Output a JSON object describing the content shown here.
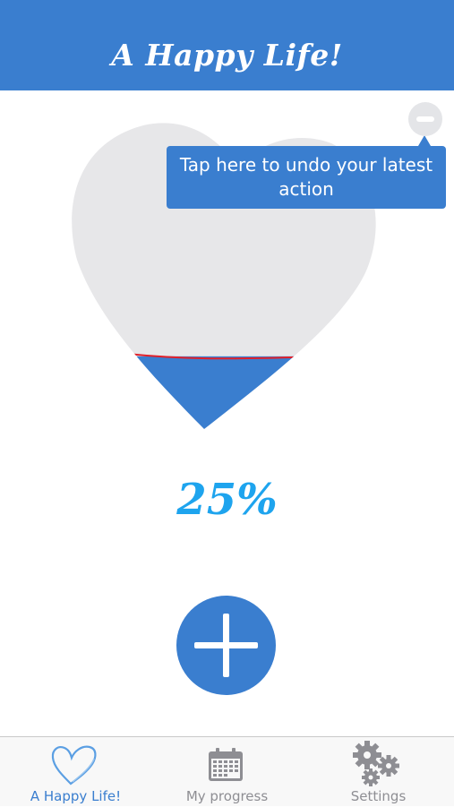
{
  "header": {
    "title": "A Happy Life!"
  },
  "progress": {
    "percent_label": "25%",
    "fill_fraction": 0.25
  },
  "undo": {
    "tooltip": "Tap here to undo your latest action"
  },
  "tabs": [
    {
      "label": "A Happy Life!",
      "icon": "heart-icon",
      "active": true
    },
    {
      "label": "My progress",
      "icon": "calendar-icon",
      "active": false
    },
    {
      "label": "Settings",
      "icon": "gears-icon",
      "active": false
    }
  ],
  "colors": {
    "accent": "#3a7ecf",
    "percent_text": "#1ea4ee",
    "heart_empty": "#e7e7e9",
    "fill_line": "#e0202a"
  }
}
